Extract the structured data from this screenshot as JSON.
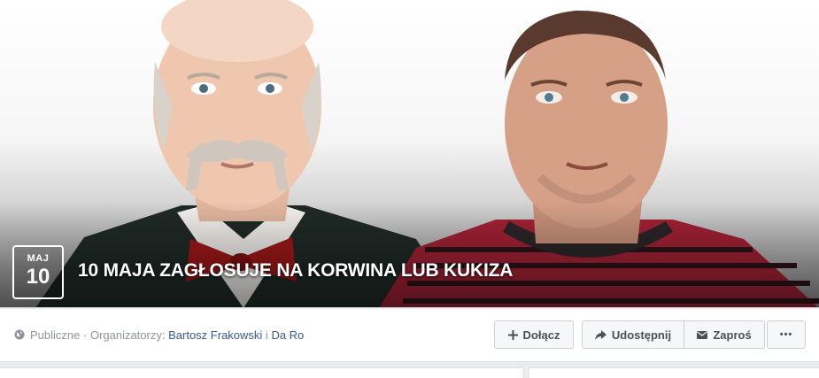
{
  "cover": {
    "date_month": "MAJ",
    "date_day": "10",
    "title": "10 MAJA ZAGŁOSUJE NA KORWINA LUB KUKIZA"
  },
  "meta": {
    "privacy": "Publiczne",
    "separator": " · ",
    "organizers_label": "Organizatorzy:",
    "organizer_1": "Bartosz Frakowski",
    "organizer_sep": " i ",
    "organizer_2": "Da Ro"
  },
  "actions": {
    "join": "Dołącz",
    "share": "Udostępnij",
    "invite": "Zaproś",
    "more": "•••"
  },
  "icons": {
    "privacy": "globe-icon",
    "join": "plus-icon",
    "share": "share-arrow-icon",
    "invite": "envelope-icon",
    "more": "ellipsis-icon"
  }
}
